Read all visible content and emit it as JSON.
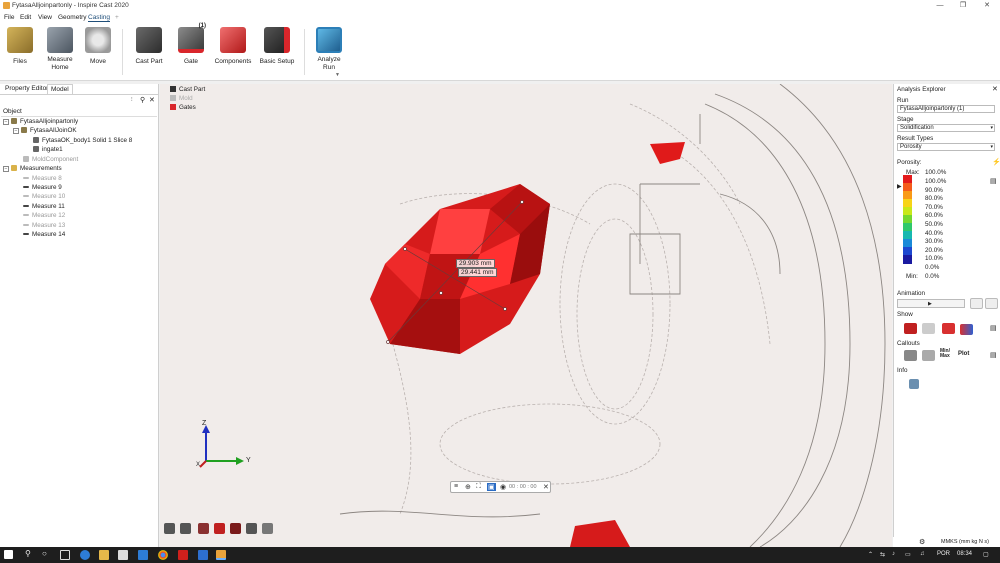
{
  "window": {
    "title": "FytasaAlljoinpartonly - Inspire Cast 2020",
    "controls": [
      "—",
      "❐",
      "✕"
    ]
  },
  "menu": {
    "items": [
      "File",
      "Edit",
      "View",
      "Geometry",
      "Casting"
    ],
    "active": "Casting",
    "add_tab": "+"
  },
  "ribbon": {
    "tools": [
      {
        "label": "Files",
        "icon": "files-icon"
      },
      {
        "label": "Measure\nHome",
        "icon": "measure-icon"
      },
      {
        "label": "Move",
        "icon": "move-icon"
      },
      {
        "label": "Cast Part",
        "icon": "cast-part-icon"
      },
      {
        "label": "Gate",
        "icon": "gate-icon",
        "badge": "(1)"
      },
      {
        "label": "Components",
        "icon": "components-icon"
      },
      {
        "label": "Basic Setup",
        "icon": "basic-setup-icon"
      },
      {
        "label": "Analyze\nRun",
        "icon": "analyze-run-icon"
      }
    ],
    "analyze_dropdown": "▼"
  },
  "left_panel": {
    "tabs": [
      "Property Editor",
      "Model"
    ],
    "active_tab": "Model",
    "column_header": "Object",
    "tree": [
      {
        "label": "FytasaAlljoinpartonly",
        "level": 0,
        "expander": "−",
        "icon": "assembly-icon",
        "disabled": false
      },
      {
        "label": "FytasaAllJoinOK",
        "level": 1,
        "expander": "−",
        "icon": "assembly-icon",
        "disabled": false
      },
      {
        "label": "FytasaOK_body1 Solid 1 Slice 8",
        "level": 2,
        "icon": "part-icon",
        "disabled": false
      },
      {
        "label": "ingate1",
        "level": 2,
        "icon": "part-icon",
        "disabled": false
      },
      {
        "label": "MoldComponent",
        "level": 1,
        "icon": "part-icon",
        "disabled": true
      },
      {
        "label": "Measurements",
        "level": 0,
        "expander": "−",
        "icon": "folder-icon",
        "disabled": false
      },
      {
        "label": "Measure 8",
        "level": 1,
        "icon": "measure-icon",
        "disabled": true
      },
      {
        "label": "Measure 9",
        "level": 1,
        "icon": "measure-icon",
        "disabled": false
      },
      {
        "label": "Measure 10",
        "level": 1,
        "icon": "measure-icon",
        "disabled": true
      },
      {
        "label": "Measure 11",
        "level": 1,
        "icon": "measure-icon",
        "disabled": false
      },
      {
        "label": "Measure 12",
        "level": 1,
        "icon": "measure-icon",
        "disabled": true
      },
      {
        "label": "Measure 13",
        "level": 1,
        "icon": "measure-icon",
        "disabled": true
      },
      {
        "label": "Measure 14",
        "level": 1,
        "icon": "measure-icon",
        "disabled": false
      }
    ]
  },
  "viewport": {
    "legend": [
      {
        "label": "Cast Part",
        "color": "#333333",
        "disabled": false
      },
      {
        "label": "Mold",
        "color": "#bbbbbb",
        "disabled": true
      },
      {
        "label": "Gates",
        "color": "#d9262b",
        "disabled": false
      }
    ],
    "measure_tag_1": "29.903 mm",
    "measure_tag_2": "29.441 mm",
    "axes": {
      "x": "X",
      "y": "Y",
      "z": "Z"
    }
  },
  "playback": {
    "time": "00 : 00 : 00",
    "close": "✕"
  },
  "right_panel": {
    "title": "Analysis Explorer",
    "run_label": "Run",
    "run_value": "FytasaAlljoinpartonly (1)",
    "stage_label": "Stage",
    "stage_value": "Solidification",
    "result_types_label": "Result Types",
    "result_types_value": "Porosity",
    "porosity_label": "Porosity:",
    "scale": {
      "max_label": "Max:",
      "max_value": "100.0%",
      "min_label": "Min:",
      "min_value": "0.0%",
      "ticks": [
        "100.0%",
        "90.0%",
        "80.0%",
        "70.0%",
        "60.0%",
        "50.0%",
        "40.0%",
        "30.0%",
        "20.0%",
        "10.0%",
        "0.0%"
      ],
      "colors": [
        "#e31a1c",
        "#f55b1b",
        "#f99a17",
        "#f7d418",
        "#c8e81a",
        "#74d830",
        "#2fc86b",
        "#17b8b0",
        "#1a8ad8",
        "#1d48d0",
        "#1a1aa0"
      ]
    },
    "animation_label": "Animation",
    "show_label": "Show",
    "callouts_label": "Callouts",
    "callouts_minmax": "Min/\nMax",
    "callouts_plot": "Plot",
    "info_label": "Info"
  },
  "status": {
    "units": "MMKS (mm kg N s)"
  },
  "taskbar": {
    "language": "POR",
    "time": "08:34"
  }
}
